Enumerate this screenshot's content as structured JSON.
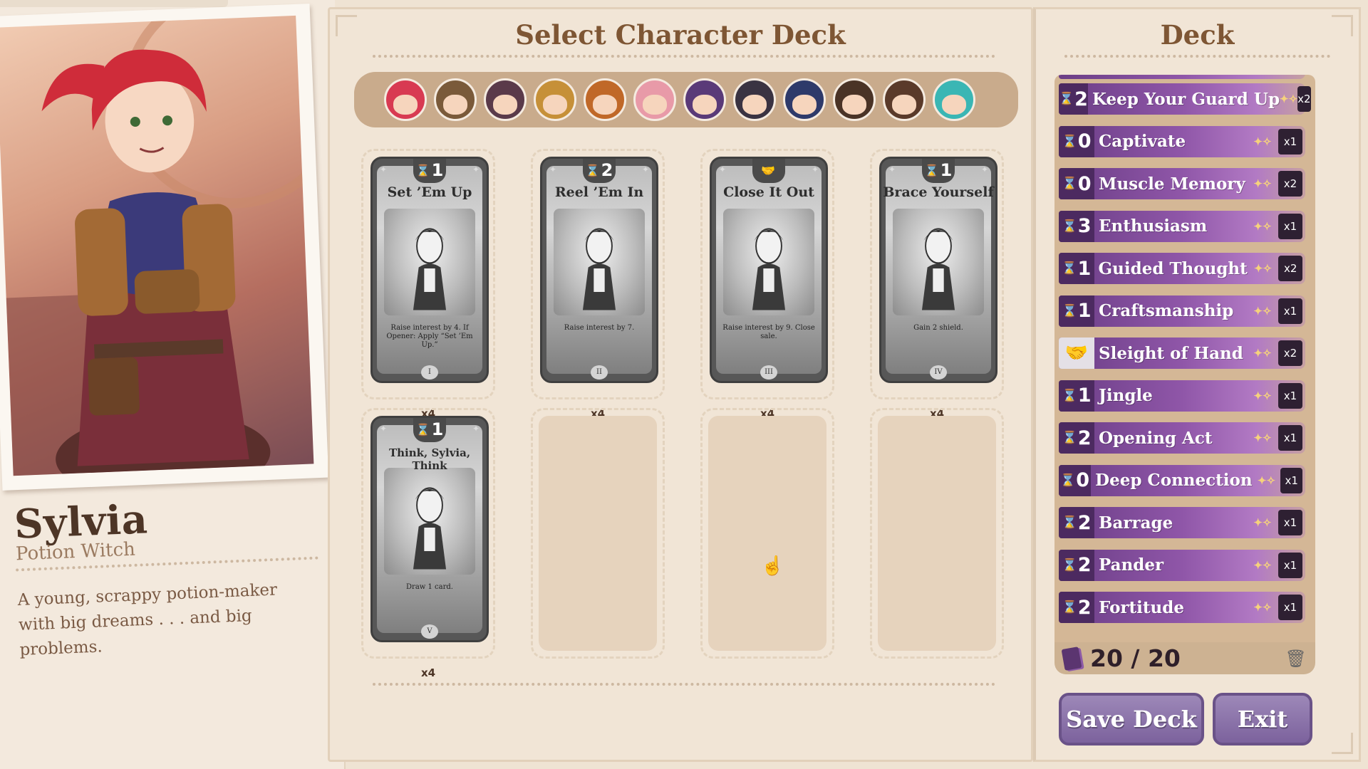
{
  "character": {
    "name": "Sylvia",
    "role": "Potion Witch",
    "description": "A young, scrappy potion-maker with big dreams . . . and big problems."
  },
  "select_panel": {
    "title": "Select Character Deck",
    "characters": [
      {
        "id": "sylvia",
        "color": "#d83a52"
      },
      {
        "id": "goggles",
        "color": "#7a5a3a"
      },
      {
        "id": "antler",
        "color": "#5a3a4a"
      },
      {
        "id": "golden",
        "color": "#c69038"
      },
      {
        "id": "lion",
        "color": "#c06828"
      },
      {
        "id": "pink-cat",
        "color": "#e89aa8"
      },
      {
        "id": "purple-witch",
        "color": "#5a3a78"
      },
      {
        "id": "black-cat",
        "color": "#3a3342"
      },
      {
        "id": "blue-hair",
        "color": "#2e3a6a"
      },
      {
        "id": "spiky",
        "color": "#4a3326"
      },
      {
        "id": "hat-guy",
        "color": "#5a3a2a"
      },
      {
        "id": "teal-hair",
        "color": "#3ab6b4"
      }
    ],
    "cards": [
      {
        "cost": "1",
        "cost_icon": "hourglass-icon",
        "title": "Set ’Em Up",
        "text": "Raise interest by 4. If Opener: Apply “Set ’Em Up.”",
        "numeral": "I",
        "count": "x4"
      },
      {
        "cost": "2",
        "cost_icon": "hourglass-icon",
        "title": "Reel ’Em In",
        "text": "Raise interest by 7.",
        "numeral": "II",
        "count": "x4"
      },
      {
        "cost": "",
        "cost_icon": "handshake-icon",
        "title": "Close It Out",
        "text": "Raise interest by 9. Close sale.",
        "numeral": "III",
        "count": "x4"
      },
      {
        "cost": "1",
        "cost_icon": "hourglass-icon",
        "title": "Brace Yourself",
        "text": "Gain 2 shield.",
        "numeral": "IV",
        "count": "x4"
      },
      {
        "cost": "1",
        "cost_icon": "hourglass-icon",
        "title": "Think, Sylvia, Think",
        "text": "Draw 1 card.",
        "numeral": "V",
        "count": "x4"
      }
    ]
  },
  "deck_panel": {
    "title": "Deck",
    "rows": [
      {
        "cost": "2",
        "type": "hourglass",
        "name": "Keep Your Guard Up",
        "qty": "x2"
      },
      {
        "cost": "0",
        "type": "hourglass",
        "name": "Captivate",
        "qty": "x1"
      },
      {
        "cost": "0",
        "type": "hourglass",
        "name": "Muscle Memory",
        "qty": "x2"
      },
      {
        "cost": "3",
        "type": "hourglass",
        "name": "Enthusiasm",
        "qty": "x1"
      },
      {
        "cost": "1",
        "type": "hourglass",
        "name": "Guided Thought",
        "qty": "x2"
      },
      {
        "cost": "1",
        "type": "hourglass",
        "name": "Craftsmanship",
        "qty": "x1"
      },
      {
        "cost": "",
        "type": "handshake",
        "name": "Sleight of Hand",
        "qty": "x2"
      },
      {
        "cost": "1",
        "type": "hourglass",
        "name": "Jingle",
        "qty": "x1"
      },
      {
        "cost": "2",
        "type": "hourglass",
        "name": "Opening Act",
        "qty": "x1"
      },
      {
        "cost": "0",
        "type": "hourglass",
        "name": "Deep Connection",
        "qty": "x1"
      },
      {
        "cost": "2",
        "type": "hourglass",
        "name": "Barrage",
        "qty": "x1"
      },
      {
        "cost": "2",
        "type": "hourglass",
        "name": "Pander",
        "qty": "x1"
      },
      {
        "cost": "2",
        "type": "hourglass",
        "name": "Fortitude",
        "qty": "x1"
      }
    ],
    "total": "20 / 20",
    "save_label": "Save Deck",
    "exit_label": "Exit"
  }
}
